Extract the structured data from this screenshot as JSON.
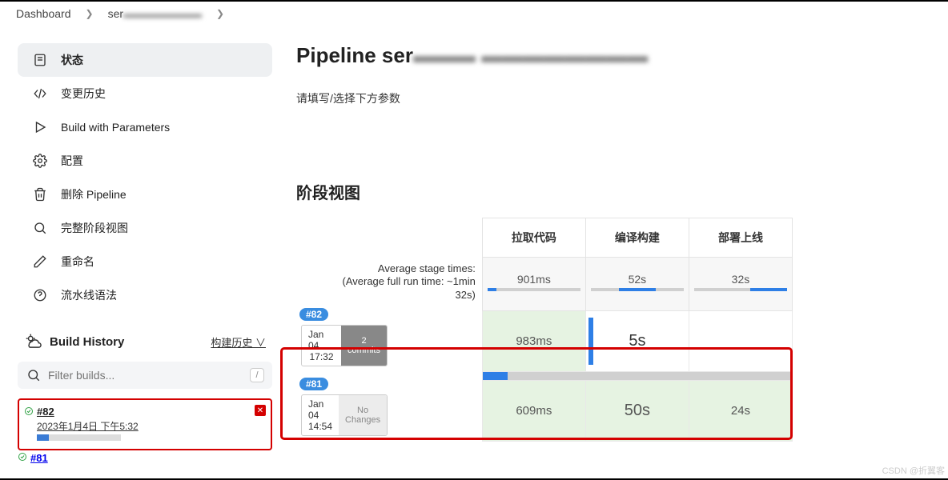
{
  "breadcrumb": {
    "root": "Dashboard",
    "item": "ser"
  },
  "sidebar": {
    "items": [
      {
        "label": "状态"
      },
      {
        "label": "变更历史"
      },
      {
        "label": "Build with Parameters"
      },
      {
        "label": "配置"
      },
      {
        "label": "删除 Pipeline"
      },
      {
        "label": "完整阶段视图"
      },
      {
        "label": "重命名"
      },
      {
        "label": "流水线语法"
      }
    ]
  },
  "history": {
    "title": "Build History",
    "trend_link": "构建历史 ∨",
    "filter_placeholder": "Filter builds...",
    "items": [
      {
        "id": "#82",
        "date": "2023年1月4日 下午5:32"
      }
    ],
    "peek_id": "#81"
  },
  "main": {
    "title_prefix": "Pipeline ser",
    "params_hint": "请填写/选择下方参数",
    "stage_heading": "阶段视图",
    "avg_label_line1": "Average stage times:",
    "avg_label_line2": "(Average full run time: ~1min",
    "avg_label_line3": "32s)",
    "stages": [
      "拉取代码",
      "编译构建",
      "部署上线"
    ],
    "averages": [
      "901ms",
      "52s",
      "32s"
    ],
    "runs": [
      {
        "badge": "#82",
        "date": "Jan 04",
        "time": "17:32",
        "changes_n": "2",
        "changes_t": "commits",
        "cells": [
          "983ms",
          "5s",
          ""
        ],
        "running": true
      },
      {
        "badge": "#81",
        "date": "Jan 04",
        "time": "14:54",
        "changes_n": "No",
        "changes_t": "Changes",
        "cells": [
          "609ms",
          "50s",
          "24s"
        ],
        "running": false
      }
    ]
  },
  "watermark": "CSDN @折翼客"
}
